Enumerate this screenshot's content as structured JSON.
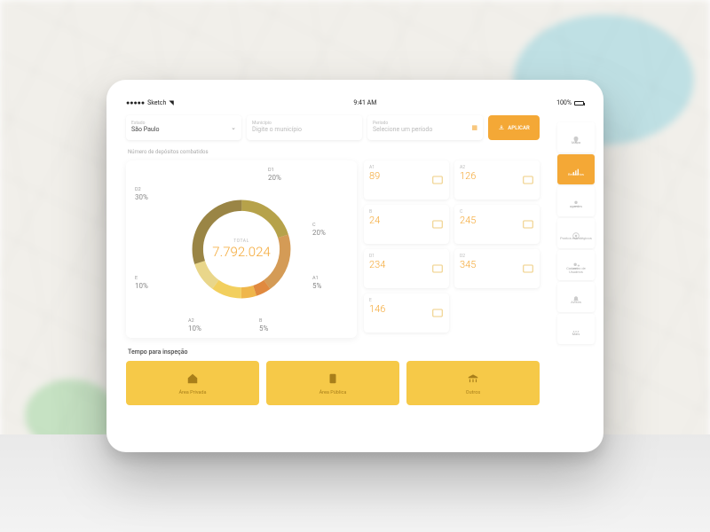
{
  "statusbar": {
    "carrier": "Sketch",
    "time": "9:41 AM",
    "battery_pct": "100%"
  },
  "filters": {
    "estado": {
      "label": "Estado",
      "value": "São Paulo"
    },
    "municipio": {
      "label": "Município",
      "placeholder": "Digite o município"
    },
    "periodo": {
      "label": "Período",
      "placeholder": "Selecione um período"
    },
    "apply_label": "APLICAR"
  },
  "depositos": {
    "title": "Número de depósitos combatidos",
    "total_label": "TOTAL",
    "total_value": "7.792.024"
  },
  "chart_data": {
    "type": "pie",
    "title": "Número de depósitos combatidos",
    "series": [
      {
        "name": "D1",
        "value": 20,
        "color": "#b6a24a"
      },
      {
        "name": "C",
        "value": 20,
        "color": "#d49b56"
      },
      {
        "name": "A1",
        "value": 5,
        "color": "#e0893f"
      },
      {
        "name": "B",
        "value": 5,
        "color": "#efb64b"
      },
      {
        "name": "A2",
        "value": 10,
        "color": "#f2cf5e"
      },
      {
        "name": "E",
        "value": 10,
        "color": "#e9d68a"
      },
      {
        "name": "D2",
        "value": 30,
        "color": "#9a8545"
      }
    ]
  },
  "tiles": [
    {
      "key": "A1",
      "value": "89",
      "icon": "water-tank"
    },
    {
      "key": "A2",
      "value": "126",
      "icon": "lid"
    },
    {
      "key": "B",
      "value": "24",
      "icon": "jar"
    },
    {
      "key": "C",
      "value": "245",
      "icon": "building"
    },
    {
      "key": "D1",
      "value": "234",
      "icon": "tire"
    },
    {
      "key": "D2",
      "value": "345",
      "icon": "cup"
    },
    {
      "key": "E",
      "value": "146",
      "icon": "tree"
    }
  ],
  "sidebar": {
    "items": [
      {
        "label": "Mapa",
        "icon": "pin"
      },
      {
        "label": "Relatórios",
        "icon": "chart",
        "active": true
      },
      {
        "label": "agentes",
        "icon": "user"
      },
      {
        "label": "Pontos estratégicos",
        "icon": "target"
      },
      {
        "label": "Cadastro de Usuários",
        "icon": "user-add"
      },
      {
        "label": "Avisos",
        "icon": "bell"
      },
      {
        "label": "Mais",
        "icon": "dots"
      }
    ]
  },
  "inspecao": {
    "title": "Tempo para inspeção",
    "cards": [
      {
        "label": "Área Privada",
        "icon": "home"
      },
      {
        "label": "Área Pública",
        "icon": "clipboard"
      },
      {
        "label": "Outros",
        "icon": "institution"
      }
    ]
  }
}
